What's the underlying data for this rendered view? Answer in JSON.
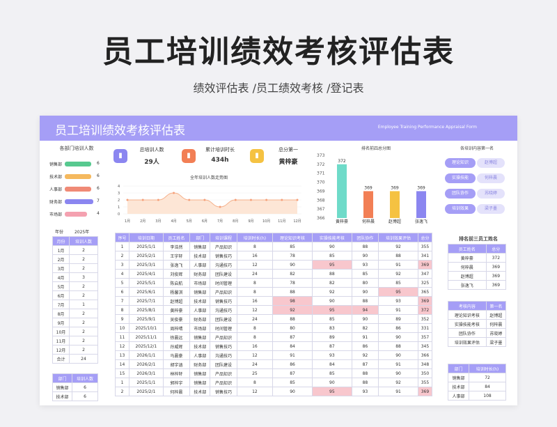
{
  "hero": {
    "title": "员工培训绩效考核评估表",
    "subtitle": "绩效评估表 /员工绩效考核 /登记表"
  },
  "banner": {
    "title": "员工培训绩效考核评估表",
    "english": "Employee Training Performance Appraisal Form"
  },
  "dept_panel": {
    "title": "各部门培训人数",
    "items": [
      {
        "label": "销售部",
        "value": "6",
        "color": "#57c98f"
      },
      {
        "label": "技术部",
        "value": "6",
        "color": "#f5b95e"
      },
      {
        "label": "人事部",
        "value": "6",
        "color": "#f08a76"
      },
      {
        "label": "财务部",
        "value": "7",
        "color": "#8b86f0"
      },
      {
        "label": "市场部",
        "value": "4",
        "color": "#f4a1b0"
      }
    ]
  },
  "kpi": [
    {
      "label": "总培训人数",
      "value": "29人",
      "icon": "bar-chart-icon",
      "color": "#8b86f0"
    },
    {
      "label": "累计培训时长",
      "value": "434h",
      "icon": "briefcase-icon",
      "color": "#f27f55"
    },
    {
      "label": "总分第一",
      "value": "黄梓豪",
      "icon": "chart-icon",
      "color": "#f5c242"
    }
  ],
  "line_chart": {
    "title": "全年培训人数走势图",
    "chart_data": {
      "type": "line",
      "categories": [
        "1月",
        "2月",
        "3月",
        "4月",
        "5月",
        "6月",
        "7月",
        "8月",
        "9月",
        "10月",
        "11月",
        "12月"
      ],
      "values": [
        2,
        2,
        2,
        3,
        2,
        2,
        1,
        2,
        2,
        2,
        2,
        2
      ],
      "ylim": [
        0,
        4
      ],
      "yticks": [
        "0",
        "1",
        "2",
        "3",
        "4"
      ]
    }
  },
  "bar_chart": {
    "title": "排名前四总分图",
    "chart_data": {
      "type": "bar",
      "categories": [
        "黄梓豪",
        "何梓晨",
        "赵博超",
        "张逸飞"
      ],
      "values": [
        372,
        369,
        369,
        369
      ],
      "ylim": [
        366,
        373
      ],
      "yticks": [
        "366",
        "367",
        "368",
        "369",
        "370",
        "371",
        "372",
        "373"
      ],
      "colors": [
        "#6fdbc9",
        "#f27f55",
        "#f5c242",
        "#8b86f0"
      ]
    }
  },
  "content_panel": {
    "title": "各培训内容第一名",
    "items": [
      {
        "label": "理论知识",
        "value": "赵博超"
      },
      {
        "label": "实操技能",
        "value": "何梓晨"
      },
      {
        "label": "团队协作",
        "value": "苏晓婷"
      },
      {
        "label": "培训效果",
        "value": "梁子墨"
      }
    ]
  },
  "month_table": {
    "year_label": "年份",
    "year": "2025年",
    "headers": [
      "月份",
      "培训人数"
    ],
    "rows": [
      [
        "1月",
        "2"
      ],
      [
        "2月",
        "2"
      ],
      [
        "3月",
        "2"
      ],
      [
        "4月",
        "3"
      ],
      [
        "5月",
        "2"
      ],
      [
        "6月",
        "2"
      ],
      [
        "7月",
        "1"
      ],
      [
        "8月",
        "2"
      ],
      [
        "9月",
        "2"
      ],
      [
        "10月",
        "2"
      ],
      [
        "11月",
        "2"
      ],
      [
        "12月",
        "2"
      ]
    ],
    "total": [
      "合计",
      "24"
    ]
  },
  "dept_table": {
    "headers": [
      "部门",
      "培训人数"
    ],
    "rows": [
      [
        "销售部",
        "6"
      ],
      [
        "技术部",
        "6"
      ]
    ]
  },
  "main_table": {
    "headers": [
      "序号",
      "培训日期",
      "员工姓名",
      "部门",
      "培训课程",
      "培训时长(h)",
      "理论知识考核",
      "实操技能考核",
      "团队协作",
      "培训效果评估",
      "总分"
    ],
    "rows": [
      [
        "1",
        "2025/1/1",
        "李浩然",
        "销售部",
        "产品知识",
        "8",
        "85",
        "90",
        "88",
        "92",
        "355"
      ],
      [
        "2",
        "2025/2/1",
        "王宇轩",
        "技术部",
        "销售技巧",
        "16",
        "78",
        "85",
        "90",
        "88",
        "341"
      ],
      [
        "3",
        "2025/3/1",
        "张逸飞",
        "人事部",
        "沟通技巧",
        "12",
        "90",
        "95",
        "93",
        "91",
        "369"
      ],
      [
        "4",
        "2025/4/1",
        "刘俊辉",
        "财务部",
        "团队建设",
        "24",
        "82",
        "88",
        "85",
        "92",
        "347"
      ],
      [
        "5",
        "2025/5/1",
        "陈启航",
        "市场部",
        "时间管理",
        "8",
        "78",
        "82",
        "80",
        "85",
        "325"
      ],
      [
        "6",
        "2025/6/1",
        "杨馨淇",
        "销售部",
        "产品知识",
        "8",
        "88",
        "92",
        "90",
        "95",
        "365"
      ],
      [
        "7",
        "2025/7/1",
        "赵博超",
        "技术部",
        "销售技巧",
        "16",
        "98",
        "90",
        "88",
        "93",
        "369"
      ],
      [
        "8",
        "2025/8/1",
        "黄梓豪",
        "人事部",
        "沟通技巧",
        "12",
        "92",
        "95",
        "94",
        "91",
        "372"
      ],
      [
        "9",
        "2025/9/1",
        "吴俊豪",
        "财务部",
        "团队建设",
        "24",
        "88",
        "85",
        "90",
        "89",
        "352"
      ],
      [
        "10",
        "2025/10/1",
        "周梓晴",
        "市场部",
        "时间管理",
        "8",
        "80",
        "83",
        "82",
        "86",
        "331"
      ],
      [
        "11",
        "2025/11/1",
        "徐晨远",
        "销售部",
        "产品知识",
        "8",
        "87",
        "89",
        "91",
        "90",
        "357"
      ],
      [
        "12",
        "2025/12/1",
        "孙威辉",
        "技术部",
        "销售技巧",
        "16",
        "84",
        "87",
        "86",
        "88",
        "345"
      ],
      [
        "13",
        "2026/1/1",
        "马晨豪",
        "人事部",
        "沟通技巧",
        "12",
        "91",
        "93",
        "92",
        "90",
        "366"
      ],
      [
        "14",
        "2026/2/1",
        "胡宇涵",
        "财务部",
        "团队建设",
        "24",
        "86",
        "84",
        "87",
        "91",
        "348"
      ],
      [
        "15",
        "2026/3/1",
        "林梓轩",
        "销售部",
        "产品知识",
        "25",
        "87",
        "85",
        "88",
        "90",
        "350"
      ],
      [
        "1",
        "2025/1/1",
        "郭梓宇",
        "销售部",
        "产品知识",
        "8",
        "85",
        "90",
        "88",
        "92",
        "355"
      ],
      [
        "2",
        "2025/2/1",
        "何梓晨",
        "技术部",
        "销售技巧",
        "12",
        "90",
        "95",
        "93",
        "91",
        "369"
      ]
    ],
    "highlights": [
      [
        2,
        7
      ],
      [
        2,
        10
      ],
      [
        5,
        9
      ],
      [
        6,
        6
      ],
      [
        6,
        10
      ],
      [
        7,
        6
      ],
      [
        7,
        7
      ],
      [
        7,
        8
      ],
      [
        7,
        10
      ],
      [
        16,
        7
      ],
      [
        16,
        10
      ]
    ]
  },
  "top3_panel": {
    "title": "排名前三员工姓名",
    "headers": [
      "员工姓名",
      "总分"
    ],
    "rows": [
      [
        "黄梓豪",
        "372"
      ],
      [
        "何梓晨",
        "369"
      ],
      [
        "赵博超",
        "369"
      ],
      [
        "张逸飞",
        "369"
      ]
    ]
  },
  "exam_panel": {
    "headers": [
      "考核内容",
      "第一名"
    ],
    "rows": [
      [
        "理论知识考核",
        "赵博超"
      ],
      [
        "实操技能考核",
        "何梓晨"
      ],
      [
        "团队协作",
        "苏晓婷"
      ],
      [
        "培训效果评估",
        "梁子墨"
      ]
    ]
  },
  "hours_panel": {
    "headers": [
      "部门",
      "培训时长(h)"
    ],
    "rows": [
      [
        "销售部",
        "72"
      ],
      [
        "技术部",
        "84"
      ],
      [
        "人事部",
        "108"
      ]
    ]
  }
}
